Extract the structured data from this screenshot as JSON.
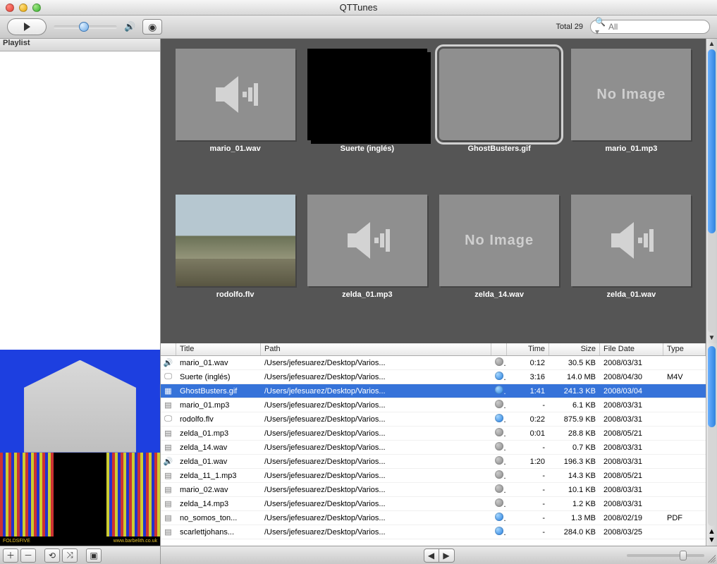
{
  "window": {
    "title": "QTTunes"
  },
  "sidebar": {
    "header": "Playlist"
  },
  "toolbar": {
    "total_label": "Total 29",
    "search_placeholder": "All"
  },
  "grid": {
    "items": [
      {
        "label": "mario_01.wav",
        "kind": "audio"
      },
      {
        "label": "Suerte (inglés)",
        "kind": "black"
      },
      {
        "label": "GhostBusters.gif",
        "kind": "ghost",
        "selected": true
      },
      {
        "label": "mario_01.mp3",
        "kind": "noimage",
        "text": "No Image"
      },
      {
        "label": "rodolfo.flv",
        "kind": "rodolfo"
      },
      {
        "label": "zelda_01.mp3",
        "kind": "audio"
      },
      {
        "label": "zelda_14.wav",
        "kind": "noimage",
        "text": "No Image"
      },
      {
        "label": "zelda_01.wav",
        "kind": "audio"
      }
    ]
  },
  "preview": {
    "footer_left": "FOLDSFIVE",
    "footer_right": "www.barbelith.co.uk"
  },
  "columns": {
    "title": "Title",
    "path": "Path",
    "time": "Time",
    "size": "Size",
    "date": "File Date",
    "type": "Type"
  },
  "rows": [
    {
      "icon": "audio",
      "title": "mario_01.wav",
      "path": "/Users/jefesuarez/Desktop/Varios...",
      "status": "gray",
      "time": "0:12",
      "size": "30.5 KB",
      "date": "2008/03/31",
      "type": ""
    },
    {
      "icon": "video",
      "title": "Suerte (inglés)",
      "path": "/Users/jefesuarez/Desktop/Varios...",
      "status": "blue",
      "time": "3:16",
      "size": "14.0 MB",
      "date": "2008/04/30",
      "type": "M4V"
    },
    {
      "icon": "image",
      "title": "GhostBusters.gif",
      "path": "/Users/jefesuarez/Desktop/Varios...",
      "status": "blue",
      "time": "1:41",
      "size": "241.3 KB",
      "date": "2008/03/04",
      "type": "",
      "selected": true
    },
    {
      "icon": "doc",
      "title": "mario_01.mp3",
      "path": "/Users/jefesuarez/Desktop/Varios...",
      "status": "gray",
      "time": "-",
      "size": "6.1 KB",
      "date": "2008/03/31",
      "type": ""
    },
    {
      "icon": "video",
      "title": "rodolfo.flv",
      "path": "/Users/jefesuarez/Desktop/Varios...",
      "status": "blue",
      "time": "0:22",
      "size": "875.9 KB",
      "date": "2008/03/31",
      "type": ""
    },
    {
      "icon": "doc",
      "title": "zelda_01.mp3",
      "path": "/Users/jefesuarez/Desktop/Varios...",
      "status": "gray",
      "time": "0:01",
      "size": "28.8 KB",
      "date": "2008/05/21",
      "type": ""
    },
    {
      "icon": "doc",
      "title": "zelda_14.wav",
      "path": "/Users/jefesuarez/Desktop/Varios...",
      "status": "gray",
      "time": "-",
      "size": "0.7 KB",
      "date": "2008/03/31",
      "type": ""
    },
    {
      "icon": "audio",
      "title": "zelda_01.wav",
      "path": "/Users/jefesuarez/Desktop/Varios...",
      "status": "gray",
      "time": "1:20",
      "size": "196.3 KB",
      "date": "2008/03/31",
      "type": ""
    },
    {
      "icon": "doc",
      "title": "zelda_11_1.mp3",
      "path": "/Users/jefesuarez/Desktop/Varios...",
      "status": "gray",
      "time": "-",
      "size": "14.3 KB",
      "date": "2008/05/21",
      "type": ""
    },
    {
      "icon": "doc",
      "title": "mario_02.wav",
      "path": "/Users/jefesuarez/Desktop/Varios...",
      "status": "gray",
      "time": "-",
      "size": "10.1 KB",
      "date": "2008/03/31",
      "type": ""
    },
    {
      "icon": "doc",
      "title": "zelda_14.mp3",
      "path": "/Users/jefesuarez/Desktop/Varios...",
      "status": "gray",
      "time": "-",
      "size": "1.2 KB",
      "date": "2008/03/31",
      "type": ""
    },
    {
      "icon": "doc",
      "title": "no_somos_ton...",
      "path": "/Users/jefesuarez/Desktop/Varios...",
      "status": "blue",
      "time": "-",
      "size": "1.3 MB",
      "date": "2008/02/19",
      "type": "PDF"
    },
    {
      "icon": "doc",
      "title": "scarlettjohans...",
      "path": "/Users/jefesuarez/Desktop/Varios...",
      "status": "blue",
      "time": "-",
      "size": "284.0 KB",
      "date": "2008/03/25",
      "type": ""
    }
  ],
  "icon_glyph": {
    "audio": "🔊",
    "video": "🖵",
    "image": "▦",
    "doc": "▤"
  }
}
